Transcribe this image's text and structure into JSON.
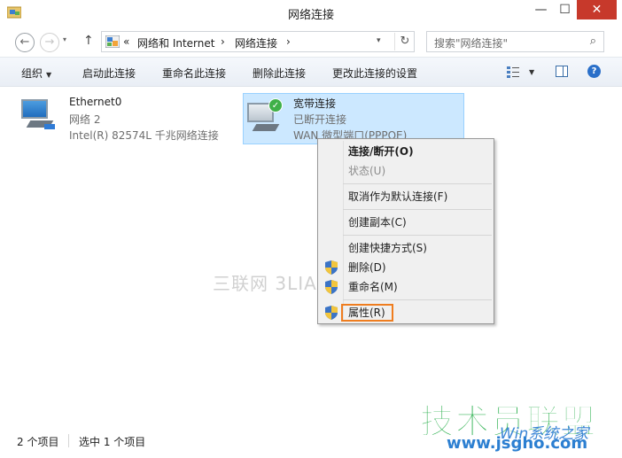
{
  "window": {
    "title": "网络连接",
    "minimize": "—",
    "maximize": "☐",
    "close": "✕"
  },
  "nav": {
    "back": "←",
    "forward": "→",
    "dropdown": "▾",
    "up": "↑"
  },
  "address": {
    "prefix": "«",
    "crumbs": [
      "网络和 Internet",
      "网络连接"
    ],
    "chevron": "›",
    "dropdown": "▾",
    "refresh": "↻"
  },
  "search": {
    "placeholder": "搜索\"网络连接\"",
    "icon": "⌕"
  },
  "commands": {
    "organize": "组织",
    "caret": "▼",
    "enable": "启动此连接",
    "rename": "重命名此连接",
    "delete": "删除此连接",
    "change_settings": "更改此连接的设置",
    "help": "?"
  },
  "items": [
    {
      "name": "Ethernet0",
      "line2": "网络 2",
      "line3": "Intel(R) 82574L 千兆网络连接"
    },
    {
      "name": "宽带连接",
      "line2": "已断开连接",
      "line3": "WAN 微型端口(PPPOE)"
    }
  ],
  "context_menu": [
    {
      "label": "连接/断开(O)",
      "bold": true
    },
    {
      "label": "状态(U)",
      "disabled": true
    },
    {
      "label": "取消作为默认连接(F)"
    },
    {
      "label": "创建副本(C)"
    },
    {
      "label": "创建快捷方式(S)"
    },
    {
      "label": "删除(D)",
      "shield": true
    },
    {
      "label": "重命名(M)",
      "shield": true
    },
    {
      "label": "属性(R)",
      "shield": true
    }
  ],
  "status": {
    "count": "2 个项目",
    "selected": "选中 1 个项目"
  },
  "watermarks": {
    "site": "三联网 3LIAN.COM",
    "logo_text": "技术员联盟",
    "logo_sub": "Win系统之家",
    "logo_url": "www.jsgho.com"
  },
  "colors": {
    "selection": "#cce8ff",
    "close_button": "#c7392b",
    "highlight_border": "#ef7d1f",
    "logo_green": "#2cb04e"
  }
}
